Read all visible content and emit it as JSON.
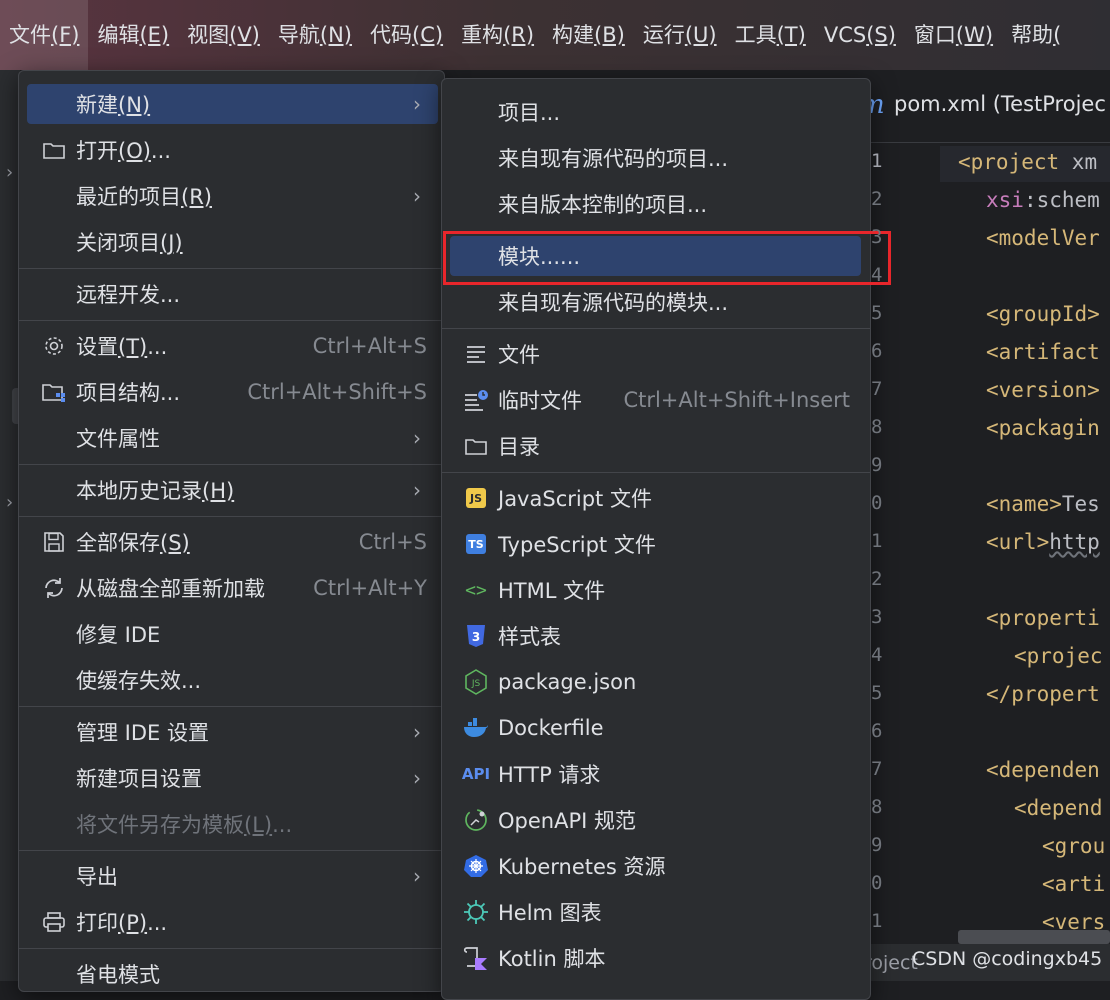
{
  "menubar": [
    {
      "label": "文件",
      "key": "(F)",
      "active": true
    },
    {
      "label": "编辑",
      "key": "(E)"
    },
    {
      "label": "视图",
      "key": "(V)"
    },
    {
      "label": "导航",
      "key": "(N)"
    },
    {
      "label": "代码",
      "key": "(C)"
    },
    {
      "label": "重构",
      "key": "(R)"
    },
    {
      "label": "构建",
      "key": "(B)"
    },
    {
      "label": "运行",
      "key": "(U)"
    },
    {
      "label": "工具",
      "key": "(T)"
    },
    {
      "label": "VCS",
      "key": "(S)"
    },
    {
      "label": "窗口",
      "key": "(W)"
    },
    {
      "label": "帮助",
      "key": "("
    }
  ],
  "file_menu": {
    "new": {
      "label": "新建",
      "key": "(N)"
    },
    "open": {
      "label": "打开",
      "key": "(O)",
      "suffix": "..."
    },
    "recent": {
      "label": "最近的项目",
      "key": "(R)"
    },
    "close": {
      "label": "关闭项目",
      "key": "(J)"
    },
    "remote": {
      "label": "远程开发..."
    },
    "settings": {
      "label": "设置",
      "key": "(T)",
      "suffix": "...",
      "shortcut": "Ctrl+Alt+S"
    },
    "structure": {
      "label": "项目结构...",
      "shortcut": "Ctrl+Alt+Shift+S"
    },
    "props": {
      "label": "文件属性"
    },
    "history": {
      "label": "本地历史记录",
      "key": "(H)"
    },
    "save_all": {
      "label": "全部保存",
      "key": "(S)",
      "shortcut": "Ctrl+S"
    },
    "reload": {
      "label": "从磁盘全部重新加载",
      "shortcut": "Ctrl+Alt+Y"
    },
    "repair": {
      "label": "修复 IDE"
    },
    "invalidate": {
      "label": "使缓存失效..."
    },
    "manage": {
      "label": "管理 IDE 设置"
    },
    "new_proj_settings": {
      "label": "新建项目设置"
    },
    "save_template": {
      "label": "将文件另存为模板",
      "key": "(L)",
      "suffix": "..."
    },
    "export": {
      "label": "导出"
    },
    "print": {
      "label": "打印",
      "key": "(P)",
      "suffix": "..."
    },
    "power_save": {
      "label": "省电模式"
    }
  },
  "new_menu": {
    "project": "项目...",
    "from_sources": "来自现有源代码的项目...",
    "from_vcs": "来自版本控制的项目...",
    "module": "模块......",
    "module_from_sources": "来自现有源代码的模块...",
    "file": "文件",
    "scratch": {
      "label": "临时文件",
      "shortcut": "Ctrl+Alt+Shift+Insert"
    },
    "directory": "目录",
    "javascript": "JavaScript 文件",
    "typescript": "TypeScript 文件",
    "html": "HTML 文件",
    "stylesheet": "样式表",
    "package_json": "package.json",
    "dockerfile": "Dockerfile",
    "http": "HTTP 请求",
    "openapi": "OpenAPI 规范",
    "kubernetes": "Kubernetes 资源",
    "helm": "Helm 图表",
    "kotlin": "Kotlin 脚本"
  },
  "editor": {
    "tab_icon": "m",
    "tab_title": "pom.xml (TestProjec",
    "line_numbers": [
      "1",
      "2",
      "3",
      "4",
      "5",
      "6",
      "7",
      "8",
      "9",
      "0",
      "1",
      "2",
      "3",
      "4",
      "5",
      "6",
      "7",
      "8",
      "9",
      "0",
      "1"
    ],
    "status_left": "roject",
    "watermark": "CSDN @codingxb45",
    "code": {
      "l1a": "<project",
      "l1b": " xm",
      "l2a": "xsi",
      "l2b": ":schem",
      "l3": "<modelVer",
      "l5": "<groupId>",
      "l6": "<artifact",
      "l7": "<version>",
      "l8": "<packagin",
      "l10a": "<name>",
      "l10b": "Tes",
      "l11a": "<url>",
      "l11b": "http",
      "l13": "<properti",
      "l14": "<projec",
      "l15": "</propert",
      "l17": "<dependen",
      "l18": "<depend",
      "l19": "<grou",
      "l20": "<arti",
      "l21": "<vers"
    }
  },
  "icons": {
    "js_badge": "JS",
    "ts_badge": "TS",
    "css_badge": "3",
    "api_badge": "API",
    "html_icon": "<>",
    "js_color": "#f0c94a",
    "ts_color": "#3f7fe0",
    "css_color": "#4169e1",
    "html_color": "#5fb65f",
    "node_color": "#5fb65f",
    "docker_color": "#3d8be0",
    "k8s_color": "#326ce5",
    "helm_color": "#4cc9b8",
    "kotlin_color": "#a97bff"
  }
}
